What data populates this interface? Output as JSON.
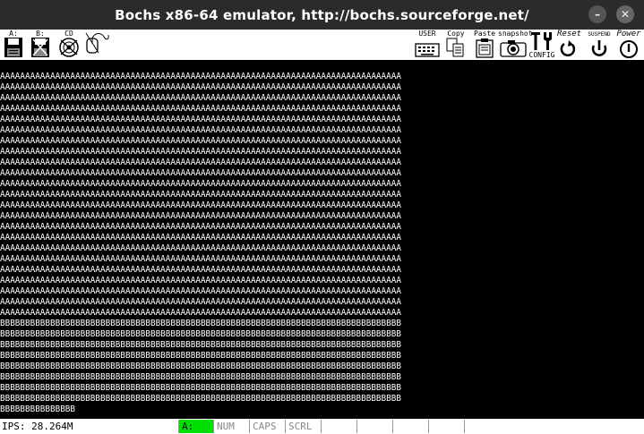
{
  "window": {
    "title": "Bochs x86-64 emulator, http://bochs.sourceforge.net/",
    "minimize_icon": "minimize-icon",
    "close_icon": "close-icon"
  },
  "toolbar": {
    "left": [
      {
        "label": "A:",
        "icon": "floppy-a-icon"
      },
      {
        "label": "B:",
        "icon": "floppy-b-icon"
      },
      {
        "label": "CD",
        "icon": "cdrom-icon"
      },
      {
        "label": "",
        "icon": "mouse-icon"
      }
    ],
    "right": [
      {
        "label": "USER",
        "icon": "keyboard-icon"
      },
      {
        "label": "Copy",
        "icon": "copy-icon"
      },
      {
        "label": "Paste",
        "icon": "paste-icon"
      },
      {
        "label": "snapshot",
        "icon": "camera-icon"
      },
      {
        "label": "CONFIG",
        "icon": "config-icon"
      },
      {
        "label": "Reset",
        "icon": "reset-icon"
      },
      {
        "label": "SUSPEND",
        "icon": "suspend-icon"
      },
      {
        "label": "Power",
        "icon": "power-icon"
      }
    ]
  },
  "screen": {
    "a_line": "AAAAAAAAAAAAAAAAAAAAAAAAAAAAAAAAAAAAAAAAAAAAAAAAAAAAAAAAAAAAAAAAAAAAAAAAAAAAAAAA",
    "a_line_count": 23,
    "b_line": "BBBBBBBBBBBBBBBBBBBBBBBBBBBBBBBBBBBBBBBBBBBBBBBBBBBBBBBBBBBBBBBBBBBBBBBBBBBBBBBB",
    "b_line_count": 8,
    "b_last": "BBBBBBBBBBBBBBB",
    "text_color": "#ffffff",
    "background": "#000000"
  },
  "status": {
    "ips": "IPS: 28.264M",
    "drive": "A:",
    "num": "NUM",
    "caps": "CAPS",
    "scrl": "SCRL",
    "drive_color": "#00e000"
  }
}
